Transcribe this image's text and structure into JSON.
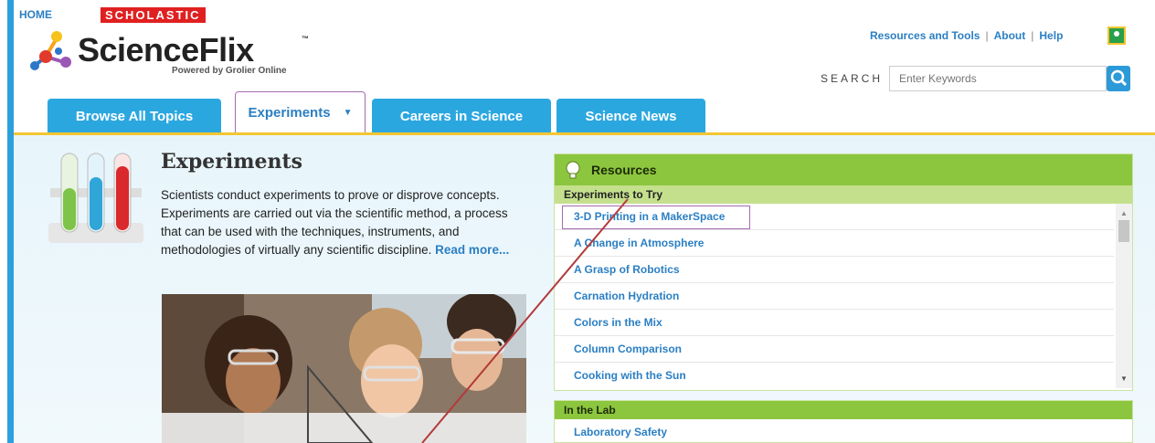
{
  "header": {
    "home": "HOME",
    "scholastic": "SCHOLASTIC",
    "logo_text": "ScienceFlix",
    "logo_tm": "™",
    "logo_sub": "Powered by Grolier Online",
    "links": [
      "Resources and Tools",
      "About",
      "Help"
    ],
    "search_label": "SEARCH",
    "search_placeholder": "Enter Keywords"
  },
  "tabs": [
    {
      "label": "Browse All Topics",
      "active": false
    },
    {
      "label": "Experiments",
      "active": true,
      "caret": "▼"
    },
    {
      "label": "Careers in Science",
      "active": false
    },
    {
      "label": "Science News",
      "active": false
    }
  ],
  "main": {
    "title": "Experiments",
    "intro": "Scientists conduct experiments to prove or disprove concepts. Experiments are carried out via the scientific method, a process that can be used with the techniques, instruments, and methodologies of virtually any scientific discipline.",
    "read_more": "Read more..."
  },
  "resources": {
    "title": "Resources",
    "section1": "Experiments to Try",
    "items": [
      "3-D Printing in a MakerSpace",
      "A Change in Atmosphere",
      "A Grasp of Robotics",
      "Carnation Hydration",
      "Colors in the Mix",
      "Column Comparison",
      "Cooking with the Sun"
    ],
    "section2": "In the Lab",
    "lab_items": [
      "Laboratory Safety"
    ]
  },
  "colors": {
    "accent_blue": "#2ba7e0",
    "link_blue": "#2b7fc3",
    "green": "#8cc63f",
    "yellow_line": "#f4c531"
  }
}
